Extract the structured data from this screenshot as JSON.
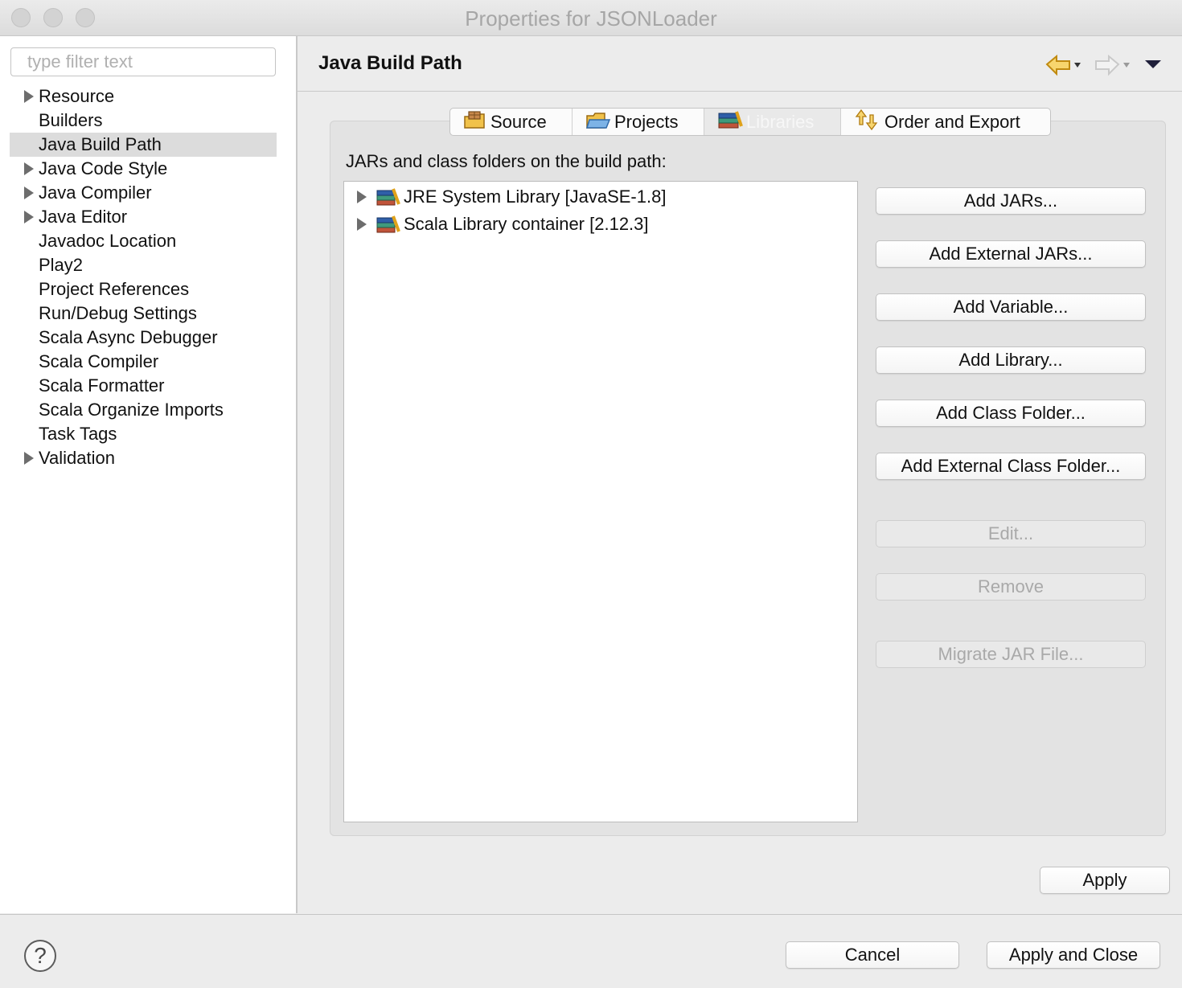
{
  "window": {
    "title": "Properties for JSONLoader"
  },
  "filter": {
    "placeholder": "type filter text"
  },
  "tree": {
    "items": [
      {
        "label": "Resource",
        "expandable": true,
        "selected": false
      },
      {
        "label": "Builders",
        "expandable": false,
        "selected": false
      },
      {
        "label": "Java Build Path",
        "expandable": false,
        "selected": true
      },
      {
        "label": "Java Code Style",
        "expandable": true,
        "selected": false
      },
      {
        "label": "Java Compiler",
        "expandable": true,
        "selected": false
      },
      {
        "label": "Java Editor",
        "expandable": true,
        "selected": false
      },
      {
        "label": "Javadoc Location",
        "expandable": false,
        "selected": false
      },
      {
        "label": "Play2",
        "expandable": false,
        "selected": false
      },
      {
        "label": "Project References",
        "expandable": false,
        "selected": false
      },
      {
        "label": "Run/Debug Settings",
        "expandable": false,
        "selected": false
      },
      {
        "label": "Scala Async Debugger",
        "expandable": false,
        "selected": false
      },
      {
        "label": "Scala Compiler",
        "expandable": false,
        "selected": false
      },
      {
        "label": "Scala Formatter",
        "expandable": false,
        "selected": false
      },
      {
        "label": "Scala Organize Imports",
        "expandable": false,
        "selected": false
      },
      {
        "label": "Task Tags",
        "expandable": false,
        "selected": false
      },
      {
        "label": "Validation",
        "expandable": true,
        "selected": false
      }
    ]
  },
  "page": {
    "title": "Java Build Path"
  },
  "tabs": [
    {
      "label": "Source",
      "icon": "source-folder-icon",
      "active": false
    },
    {
      "label": "Projects",
      "icon": "projects-folder-icon",
      "active": false
    },
    {
      "label": "Libraries",
      "icon": "library-icon",
      "active": true
    },
    {
      "label": "Order and Export",
      "icon": "order-export-icon",
      "active": false
    }
  ],
  "libraries": {
    "label": "JARs and class folders on the build path:",
    "entries": [
      {
        "label": "JRE System Library [JavaSE-1.8]"
      },
      {
        "label": "Scala Library container [2.12.3]"
      }
    ]
  },
  "buttons": {
    "add_jars": "Add JARs...",
    "add_external_jars": "Add External JARs...",
    "add_variable": "Add Variable...",
    "add_library": "Add Library...",
    "add_class_folder": "Add Class Folder...",
    "add_external_class_folder": "Add External Class Folder...",
    "edit": "Edit...",
    "remove": "Remove",
    "migrate_jar": "Migrate JAR File...",
    "apply": "Apply",
    "cancel": "Cancel",
    "apply_and_close": "Apply and Close"
  },
  "help": {
    "symbol": "?"
  },
  "colors": {
    "selection": "#dcdcdc",
    "arrow_accent": "#e0a21a"
  }
}
